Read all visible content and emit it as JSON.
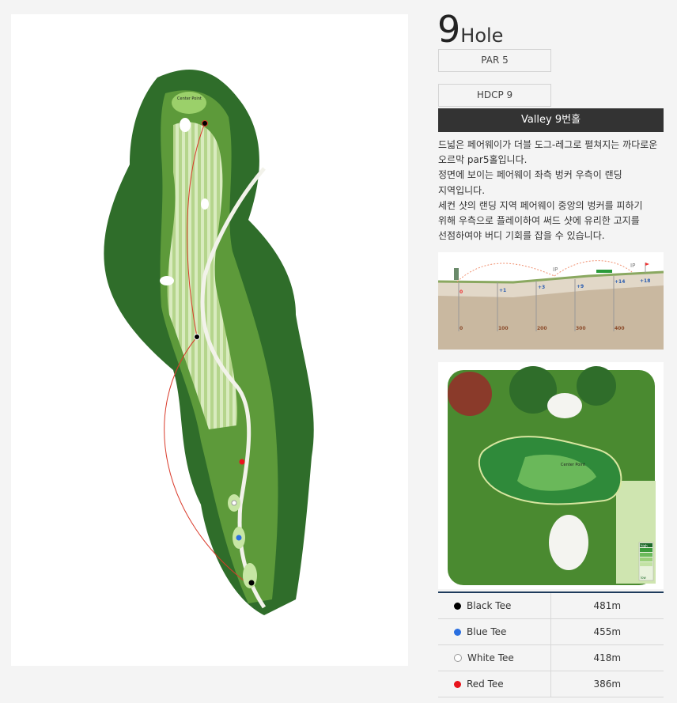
{
  "hole": {
    "number": "9",
    "label": "Hole",
    "par": "PAR 5",
    "hdcp": "HDCP 9",
    "course_name": "Valley 9번홀"
  },
  "description": [
    "드넓은 페어웨이가 더블 도그-레그로 펼쳐지는 까다로운",
    "오르막 par5홀입니다.",
    "정면에 보이는 페어웨이 좌측 벙커 우측이 랜딩",
    "지역입니다.",
    "세컨 샷의 랜딩 지역 페어웨이 중앙의 벙커를 피하기",
    "위해 우측으로 플레이하여 써드 샷에 유리한 고지를",
    "선점하여야 버디 기회를 잡을 수 있습니다."
  ],
  "map": {
    "center_point_label": "Center Point"
  },
  "profile": {
    "elevations": [
      "0",
      "+1",
      "+3",
      "+9",
      "+14",
      "+18"
    ],
    "distances": [
      "0",
      "100",
      "200",
      "300",
      "400"
    ],
    "ip_label": "IP"
  },
  "green": {
    "center_point_label": "Center Point",
    "legend_high": "high",
    "legend_low": "low"
  },
  "tees": [
    {
      "name": "Black Tee",
      "distance": "481m",
      "color": "#000000"
    },
    {
      "name": "Blue Tee",
      "distance": "455m",
      "color": "#2a6fe0"
    },
    {
      "name": "White Tee",
      "distance": "418m",
      "color": "#ffffff"
    },
    {
      "name": "Red Tee",
      "distance": "386m",
      "color": "#e8141c"
    }
  ]
}
